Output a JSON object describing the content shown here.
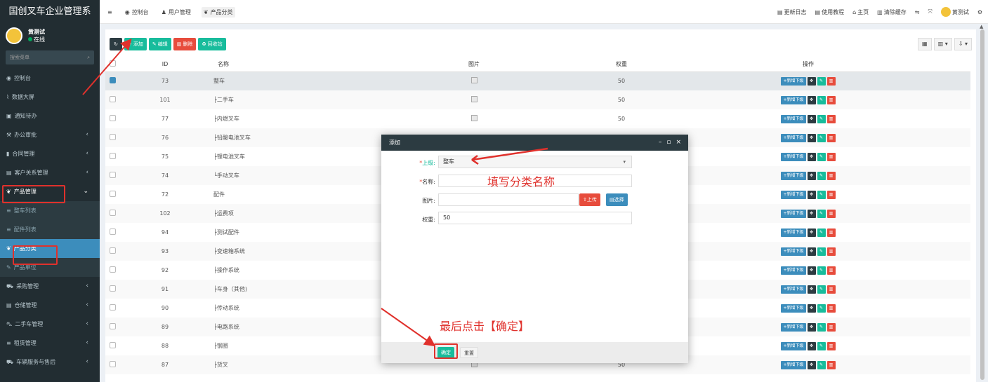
{
  "app": {
    "brand": "国创叉车企业管理系"
  },
  "topnav": [
    {
      "icon": "dashboard-icon",
      "label": "控制台"
    },
    {
      "icon": "users-icon",
      "label": "用户管理"
    },
    {
      "icon": "leaf-icon",
      "label": "产品分类"
    }
  ],
  "topright": {
    "changelog": "更新日志",
    "tutorial": "使用教程",
    "home": "主页",
    "clear_cache": "清除缓存",
    "username": "黄测试"
  },
  "user": {
    "name": "黄测试",
    "status": "在线"
  },
  "sidebar": {
    "search_placeholder": "搜索菜单",
    "items": [
      {
        "label": "控制台",
        "icon": "dashboard-icon",
        "arrow": ""
      },
      {
        "label": "数据大屏",
        "icon": "chart-line-icon",
        "arrow": ""
      },
      {
        "label": "通知待办",
        "icon": "calendar-icon",
        "arrow": ""
      },
      {
        "label": "办公审批",
        "icon": "gavel-icon",
        "arrow": "‹"
      },
      {
        "label": "合同管理",
        "icon": "bookmark-icon",
        "arrow": "‹"
      },
      {
        "label": "客户关系管理",
        "icon": "id-card-icon",
        "arrow": "‹"
      },
      {
        "label": "产品管理",
        "icon": "leaf-icon",
        "arrow": "⌄"
      },
      {
        "label": "整车列表",
        "icon": "list-icon",
        "arrow": ""
      },
      {
        "label": "配件列表",
        "icon": "list-icon",
        "arrow": ""
      },
      {
        "label": "产品分类",
        "icon": "leaf-icon",
        "arrow": ""
      },
      {
        "label": "产品单位",
        "icon": "wrench-icon",
        "arrow": ""
      },
      {
        "label": "采购管理",
        "icon": "cart-icon",
        "arrow": "‹"
      },
      {
        "label": "仓储管理",
        "icon": "database-icon",
        "arrow": "‹"
      },
      {
        "label": "二手车管理",
        "icon": "car-icon",
        "arrow": "‹"
      },
      {
        "label": "租赁管理",
        "icon": "list-icon",
        "arrow": "‹"
      },
      {
        "label": "车辆服务与售后",
        "icon": "truck-icon",
        "arrow": "‹"
      }
    ]
  },
  "toolbar": {
    "add": "添加",
    "edit": "编辑",
    "delete": "删除",
    "recycle": "回收站"
  },
  "table": {
    "headers": [
      "ID",
      "名称",
      "图片",
      "权重",
      "操作"
    ],
    "add_child_label": "新增下级",
    "rows": [
      {
        "id": "73",
        "name": "整车",
        "image": true,
        "weight": "50",
        "checked": true
      },
      {
        "id": "101",
        "name": "├二手车",
        "image": true,
        "weight": "50",
        "checked": false
      },
      {
        "id": "77",
        "name": "├内燃叉车",
        "image": true,
        "weight": "50",
        "checked": false
      },
      {
        "id": "76",
        "name": "├铅酸电池叉车",
        "image": false,
        "weight": "",
        "checked": false
      },
      {
        "id": "75",
        "name": "├锂电池叉车",
        "image": false,
        "weight": "",
        "checked": false
      },
      {
        "id": "74",
        "name": "└手动叉车",
        "image": false,
        "weight": "",
        "checked": false
      },
      {
        "id": "72",
        "name": "配件",
        "image": false,
        "weight": "",
        "checked": false
      },
      {
        "id": "102",
        "name": "├运费项",
        "image": false,
        "weight": "",
        "checked": false
      },
      {
        "id": "94",
        "name": "├测试配件",
        "image": false,
        "weight": "",
        "checked": false
      },
      {
        "id": "93",
        "name": "├变速箱系统",
        "image": false,
        "weight": "",
        "checked": false
      },
      {
        "id": "92",
        "name": "├操作系统",
        "image": false,
        "weight": "",
        "checked": false
      },
      {
        "id": "91",
        "name": "├车身（其他)",
        "image": false,
        "weight": "",
        "checked": false
      },
      {
        "id": "90",
        "name": "├传动系统",
        "image": false,
        "weight": "",
        "checked": false
      },
      {
        "id": "89",
        "name": "├电路系统",
        "image": false,
        "weight": "",
        "checked": false
      },
      {
        "id": "88",
        "name": "├钢圈",
        "image": false,
        "weight": "",
        "checked": false
      },
      {
        "id": "87",
        "name": "├货叉",
        "image": true,
        "weight": "50",
        "checked": false
      }
    ]
  },
  "modal": {
    "title": "添加",
    "parent_label": "上级:",
    "parent_value": "整车",
    "name_label": "名称:",
    "name_value": "",
    "image_label": "图片:",
    "upload": "上传",
    "choose": "选择",
    "weight_label": "权重:",
    "weight_value": "50",
    "confirm": "确定",
    "reset": "重置"
  },
  "annotations": {
    "fill_name": "填写分类名称",
    "click_confirm": "最后点击【确定】"
  },
  "colors": {
    "sidebar_bg": "#222d32",
    "primary": "#3c8dbc",
    "success": "#18bc9c",
    "danger": "#e74c3c",
    "annotation": "#e0312c"
  }
}
